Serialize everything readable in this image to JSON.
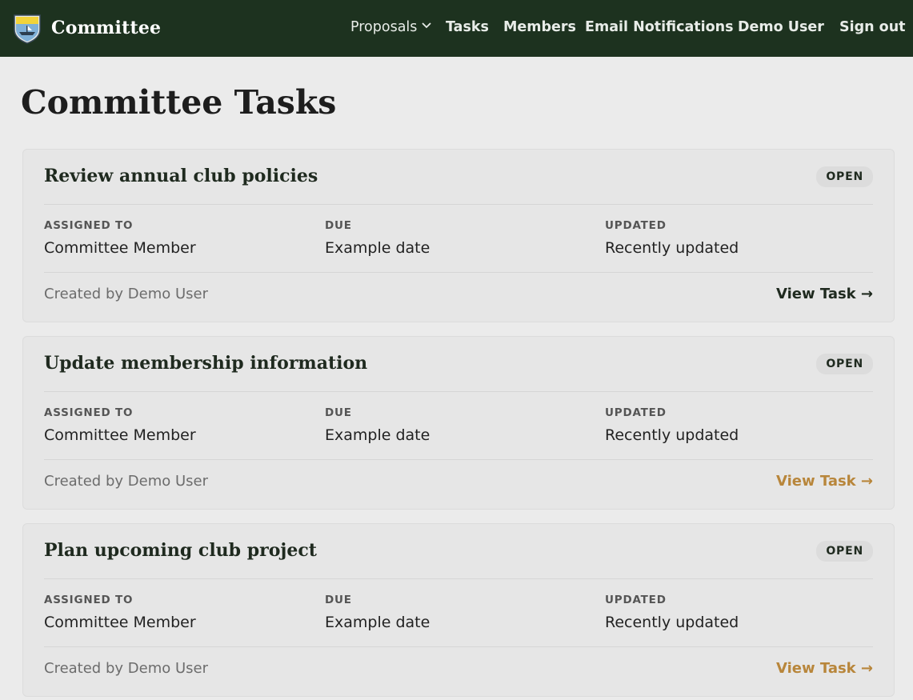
{
  "header": {
    "brand": "Committee",
    "nav": {
      "proposals": "Proposals",
      "tasks": "Tasks",
      "members": "Members",
      "email_notifications": "Email Notifications",
      "user": "Demo User",
      "sign_out": "Sign out"
    },
    "icons": {
      "logo": "club-crest-icon",
      "proposals_caret": "chevron-down-icon"
    }
  },
  "page": {
    "title": "Committee Tasks"
  },
  "labels": {
    "assigned_to": "ASSIGNED TO",
    "due": "DUE",
    "updated": "UPDATED"
  },
  "colors": {
    "nav_bg": "#1d321f",
    "link_dark": "#1f2a1f",
    "link_accent": "#b8863b"
  },
  "tasks": [
    {
      "title": "Review annual club policies",
      "status": "OPEN",
      "assigned_to": "Committee Member",
      "due": "Example date",
      "updated": "Recently updated",
      "created_by": "Created by Demo User",
      "view_label": "View Task →",
      "link_color": "#1f2a1f"
    },
    {
      "title": "Update membership information",
      "status": "OPEN",
      "assigned_to": "Committee Member",
      "due": "Example date",
      "updated": "Recently updated",
      "created_by": "Created by Demo User",
      "view_label": "View Task →",
      "link_color": "#b8863b"
    },
    {
      "title": "Plan upcoming club project",
      "status": "OPEN",
      "assigned_to": "Committee Member",
      "due": "Example date",
      "updated": "Recently updated",
      "created_by": "Created by Demo User",
      "view_label": "View Task →",
      "link_color": "#b8863b"
    }
  ]
}
